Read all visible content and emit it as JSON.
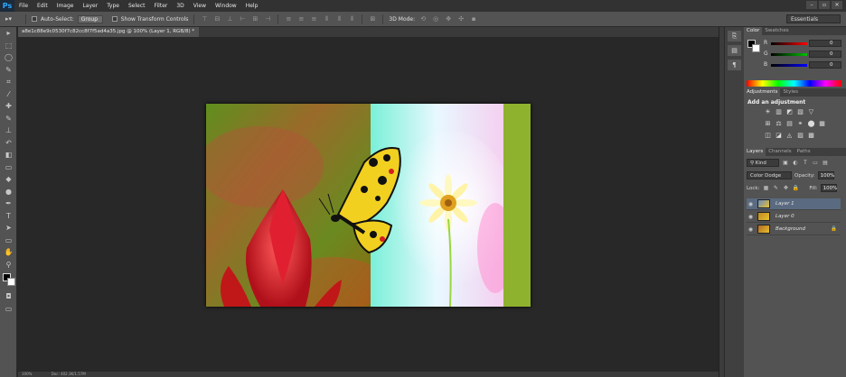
{
  "app": {
    "logo": "Ps"
  },
  "menu": [
    "File",
    "Edit",
    "Image",
    "Layer",
    "Type",
    "Select",
    "Filter",
    "3D",
    "View",
    "Window",
    "Help"
  ],
  "window_controls": [
    "–",
    "▫",
    "✕"
  ],
  "options": {
    "auto_select_label": "Auto-Select:",
    "auto_select_value": "Group",
    "transform_label": "Show Transform Controls",
    "mode_3d_label": "3D Mode:",
    "workspace": "Essentials"
  },
  "document": {
    "tab_title": "a8e1c88e9c0530f7c82cc8f7f5ad4a35.jpg @ 100% (Layer 1, RGB/8) *",
    "close": "×"
  },
  "tools": [
    "move-icon",
    "marquee-icon",
    "lasso-icon",
    "quick-select-icon",
    "crop-icon",
    "eyedropper-icon",
    "healing-icon",
    "brush-icon",
    "stamp-icon",
    "history-brush-icon",
    "eraser-icon",
    "gradient-icon",
    "blur-icon",
    "dodge-icon",
    "pen-icon",
    "type-icon",
    "path-select-icon",
    "shape-icon",
    "hand-icon",
    "zoom-icon"
  ],
  "tool_glyphs": [
    "▸",
    "⬚",
    "◯",
    "✎",
    "⌗",
    "⁄",
    "✚",
    "✎",
    "⊥",
    "↶",
    "◧",
    "▭",
    "◆",
    "●",
    "✒",
    "T",
    "➤",
    "▭",
    "✋",
    "⚲"
  ],
  "color_panel": {
    "tabs": [
      "Color",
      "Swatches"
    ],
    "sliders": [
      {
        "label": "R",
        "value": "0",
        "gradient": "#ff0000"
      },
      {
        "label": "G",
        "value": "0",
        "gradient": "#00c000"
      },
      {
        "label": "B",
        "value": "0",
        "gradient": "#0000ff"
      }
    ]
  },
  "adjustments_panel": {
    "tabs": [
      "Adjustments",
      "Styles"
    ],
    "title": "Add an adjustment",
    "rows": [
      [
        "☀",
        "▥",
        "◩",
        "▧",
        "▽"
      ],
      [
        "⊞",
        "⚖",
        "▤",
        "⚭",
        "⬤",
        "▦"
      ],
      [
        "◫",
        "◪",
        "◬",
        "▨",
        "▩"
      ]
    ]
  },
  "layers_panel": {
    "tabs": [
      "Layers",
      "Channels",
      "Paths"
    ],
    "kind_filter": "Kind",
    "blend_mode": "Color Dodge",
    "opacity_label": "Opacity:",
    "opacity_value": "100%",
    "lock_label": "Lock:",
    "fill_label": "Fill:",
    "fill_value": "100%",
    "layers": [
      {
        "name": "Layer 1",
        "selected": true
      },
      {
        "name": "Layer 0",
        "selected": false
      },
      {
        "name": "Background",
        "selected": false,
        "locked": true
      }
    ]
  },
  "status": {
    "zoom": "100%",
    "doc_info": "Doc: 402.3K/1.57M"
  }
}
